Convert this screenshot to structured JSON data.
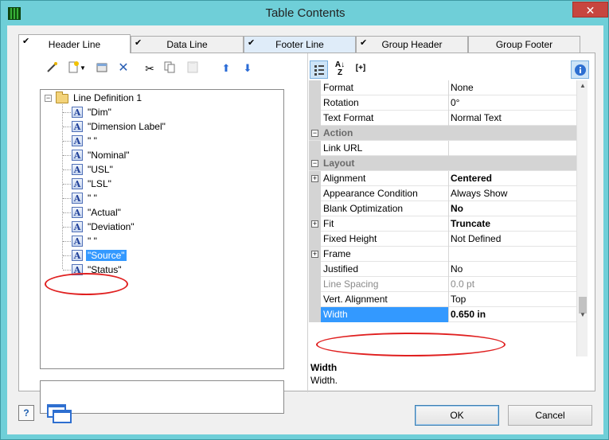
{
  "window": {
    "title": "Table Contents",
    "close_glyph": "✕"
  },
  "tabs": [
    {
      "label": "Header Line",
      "checked": true,
      "active": true
    },
    {
      "label": "Data Line",
      "checked": true
    },
    {
      "label": "Footer Line",
      "checked": true
    },
    {
      "label": "Group Header",
      "checked": true
    },
    {
      "label": "Group Footer",
      "checked": false
    }
  ],
  "left_toolbar": {
    "icons": [
      "wand-icon",
      "new-item-icon",
      "dropdown-arrow-icon",
      "properties-icon",
      "delete-icon",
      "cut-icon",
      "copy-icon",
      "paste-icon",
      "move-up-icon",
      "move-down-icon"
    ]
  },
  "tree": {
    "root": {
      "label": "Line Definition  1",
      "expanded": true
    },
    "items": [
      {
        "label": "\"Dim\""
      },
      {
        "label": "\"Dimension Label\""
      },
      {
        "label": "\" \""
      },
      {
        "label": "\"Nominal\""
      },
      {
        "label": "\"USL\""
      },
      {
        "label": "\"LSL\""
      },
      {
        "label": "\" \""
      },
      {
        "label": "\"Actual\""
      },
      {
        "label": "\"Deviation\""
      },
      {
        "label": "\" \""
      },
      {
        "label": "\"Source\"",
        "selected": true
      },
      {
        "label": "\"Status\""
      }
    ]
  },
  "right_toolbar": {
    "icons": [
      "categorized-view-icon",
      "sort-alpha-icon",
      "expand-brackets-icon",
      "info-icon"
    ],
    "expand_label": "[+]"
  },
  "properties": [
    {
      "name": "Format",
      "value": "None"
    },
    {
      "name": "Rotation",
      "value": "0°"
    },
    {
      "name": "Text Format",
      "value": "Normal Text"
    },
    {
      "name": "Action",
      "category": true
    },
    {
      "name": "Link URL",
      "value": ""
    },
    {
      "name": "Layout",
      "category": true
    },
    {
      "name": "Alignment",
      "value": "Centered",
      "bold": true,
      "expandable": true
    },
    {
      "name": "Appearance Condition",
      "value": "Always Show"
    },
    {
      "name": "Blank Optimization",
      "value": "No",
      "bold": true
    },
    {
      "name": "Fit",
      "value": "Truncate",
      "bold": true,
      "expandable": true
    },
    {
      "name": "Fixed Height",
      "value": "Not Defined"
    },
    {
      "name": "Frame",
      "value": "",
      "expandable": true
    },
    {
      "name": "Justified",
      "value": "No"
    },
    {
      "name": "Line Spacing",
      "value": "0.0 pt",
      "disabled": true
    },
    {
      "name": "Vert. Alignment",
      "value": "Top"
    },
    {
      "name": "Width",
      "value": "0.650 in",
      "bold": true,
      "selected": true
    }
  ],
  "help": {
    "title": "Width",
    "text": "Width."
  },
  "buttons": {
    "ok": "OK",
    "cancel": "Cancel",
    "help_glyph": "?"
  },
  "colors": {
    "selection": "#3399ff",
    "annotation": "#e02020",
    "frame": "#6fcfd8"
  }
}
